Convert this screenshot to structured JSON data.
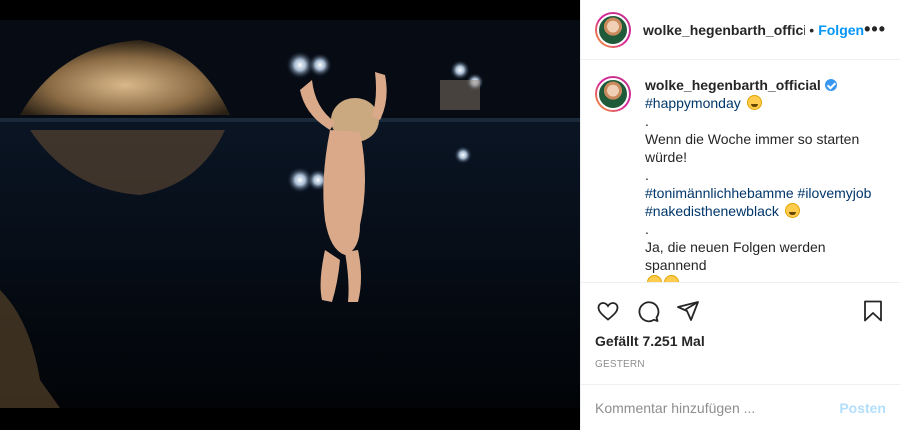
{
  "header": {
    "username": "wolke_hegenbarth_officia",
    "separator": "•",
    "follow_label": "Folgen",
    "more_label": "•••"
  },
  "caption": {
    "username": "wolke_hegenbarth_official",
    "verified": true,
    "hashtag_1": "#happymonday",
    "dot_1": ".",
    "text_1": "Wenn die Woche immer so starten würde!",
    "dot_2": ".",
    "hashtags_2a": "#tonimännlichhebamme",
    "hashtags_2b": "#ilovemyjob",
    "hashtag_3": "#nakedisthenewblack",
    "dot_3": ".",
    "text_2": "Ja, die neuen Folgen werden spannend"
  },
  "actions": {
    "likes": "Gefällt 7.251 Mal",
    "date": "GESTERN"
  },
  "comment_box": {
    "placeholder": "Kommentar hinzufügen ...",
    "post_label": "Posten"
  },
  "icons": [
    "heart-icon",
    "comment-icon",
    "share-icon",
    "bookmark-icon",
    "verified-badge-icon",
    "more-icon"
  ],
  "colors": {
    "link_blue": "#0095f6",
    "hashtag": "#00376b",
    "muted": "#8e8e8e",
    "post_disabled": "#b2dffc"
  }
}
